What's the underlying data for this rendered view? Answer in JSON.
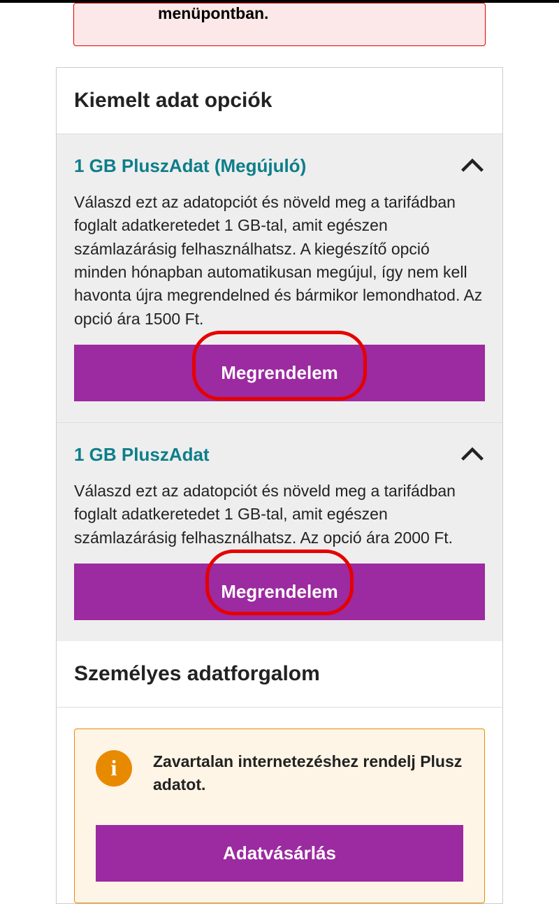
{
  "error": {
    "text": "menüpontban."
  },
  "featured": {
    "heading": "Kiemelt adat opciók",
    "options": [
      {
        "title": "1 GB PluszAdat (Megújuló)",
        "description": "Válaszd ezt az adatopciót és növeld meg a tarifádban foglalt adatkeretedet 1 GB-tal, amit egészen számlazárásig felhasználhatsz. A kiegészítő opció minden hónapban automatikusan megújul, így nem kell havonta újra megrendelned és bármikor lemondhatod. Az opció ára 1500 Ft.",
        "button_label": "Megrendelem"
      },
      {
        "title": "1 GB PluszAdat",
        "description": "Válaszd ezt az adatopciót és növeld meg a tarifádban foglalt adatkeretedet 1 GB-tal, amit egészen számlazárásig felhasználhatsz. Az opció ára 2000 Ft.",
        "button_label": "Megrendelem"
      }
    ]
  },
  "personal": {
    "heading": "Személyes adatforgalom",
    "info_text": "Zavartalan internetezéshez rendelj Plusz adatot.",
    "button_label": "Adatvásárlás"
  }
}
